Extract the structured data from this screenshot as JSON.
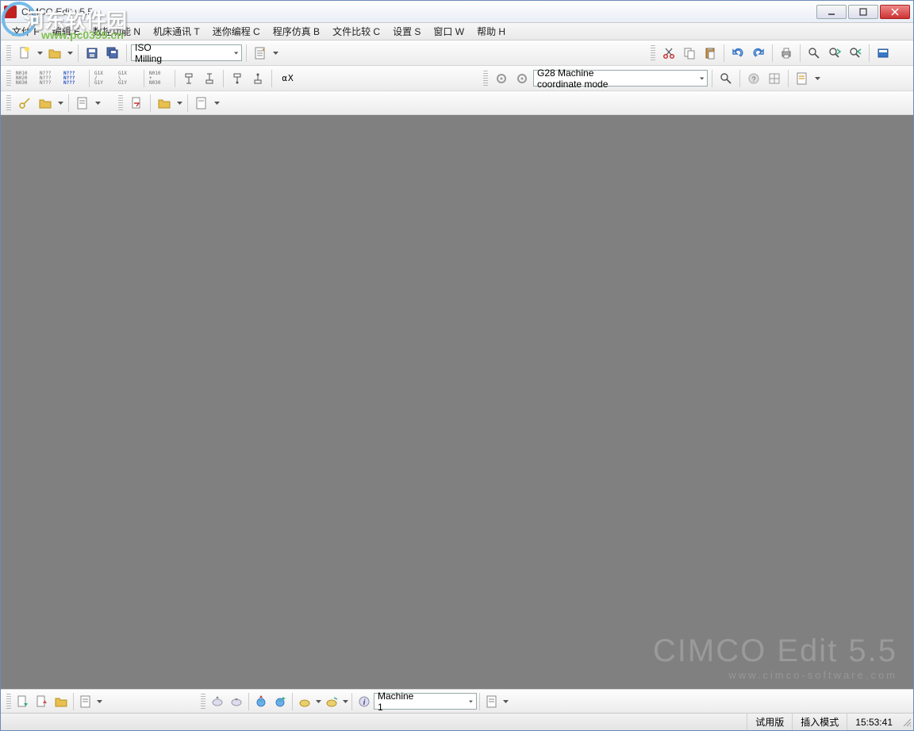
{
  "titlebar": {
    "title": "CIMCO Edit v5.5"
  },
  "menu": {
    "file": "文件 F",
    "edit": "编辑 E",
    "nc": "数控功能 N",
    "mc": "机床通讯 T",
    "mini": "迷你编程 C",
    "sim": "程序仿真 B",
    "compare": "文件比较 C",
    "settings": "设置 S",
    "window": "窗口 W",
    "help": "帮助 H"
  },
  "toolbar1": {
    "machine_type": "ISO Milling"
  },
  "toolbar2": {
    "n010": "N010",
    "n020": "N020",
    "n030": "N030",
    "nq": "N???",
    "g1x": "G1X",
    "g1y": "G1Y",
    "alphax": "αX"
  },
  "toolbar_right": {
    "gmode": "G28 Machine coordinate mode"
  },
  "bottom": {
    "machine": "Machine 1"
  },
  "watermark": {
    "big": "CIMCO Edit 5.5",
    "small": "www.cimco-software.com"
  },
  "overlay": {
    "line1": "河东软件园",
    "line2": "www.pc0359.cn"
  },
  "status": {
    "trial": "试用版",
    "mode": "插入模式",
    "time": "15:53:41"
  }
}
